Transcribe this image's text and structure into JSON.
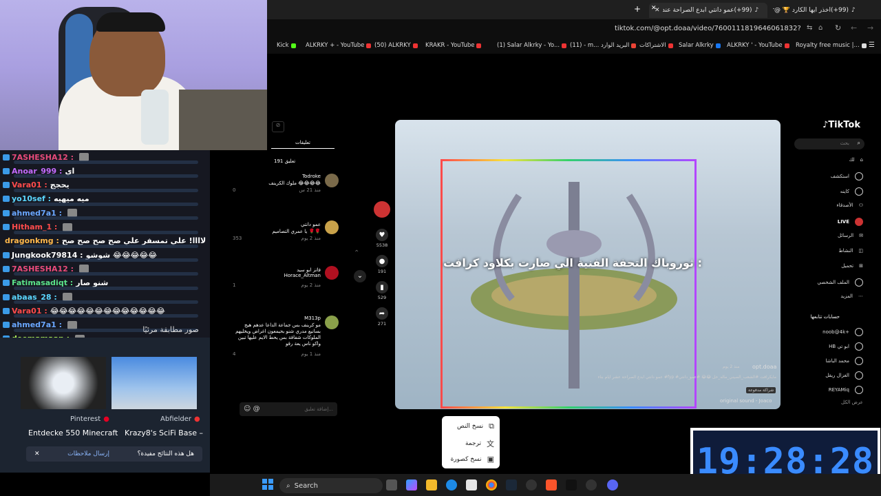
{
  "browser": {
    "tabs": [
      {
        "title": "(99+)اخذر أيها الكارد 🏆 @Over"
      },
      {
        "title": "(99+)عمو دانتي ابدع الصراحة عند"
      }
    ],
    "url": "tiktok.com/@opt.doaa/video/7600111819646061832?lang=ar",
    "bookmarks": [
      "Kick",
      "ALKRKY + - YouTube",
      "(50) ALKRKY",
      "KRAKR - YouTube",
      "(1) Salar Alkrky - Yo...",
      "(11) - m... البريد الوارد",
      "الاشتراكات",
      "Salar Alkrky",
      "ALKRKY ' - YouTube",
      "Royalty free music |..."
    ]
  },
  "chat": {
    "messages": [
      {
        "user": "7ASHESHA12 :",
        "msg": "",
        "color": "#e94b7b"
      },
      {
        "user": "Anoar_999 :",
        "msg": "اي",
        "color": "#c56bff"
      },
      {
        "user": "Vara01 :",
        "msg": "يحجج",
        "color": "#ff4b4b"
      },
      {
        "user": "yo10sef :",
        "msg": "ميه ميهيه",
        "color": "#5bd7ff"
      },
      {
        "user": "ahmed7a1 :",
        "msg": "",
        "color": "#6aa7ff"
      },
      {
        "user": "Hitham_1 :",
        "msg": "",
        "color": "#ff4b4b"
      },
      {
        "user": "dragonkmg :",
        "msg": "علي شوشو لاااا! علي تمسفر علي صح صح صح صح",
        "color": "#ffb84b"
      },
      {
        "user": "Jungkook79814 :",
        "msg": "شوشو 😂😂😂😂😂",
        "color": "#ffffff"
      },
      {
        "user": "7ASHESHA12 :",
        "msg": "",
        "color": "#e94b7b"
      },
      {
        "user": "Fatimasadiqt :",
        "msg": "شنو صار",
        "color": "#5be38a"
      },
      {
        "user": "abaas_28 :",
        "msg": "",
        "color": "#5bd7ff"
      },
      {
        "user": "Vara01 :",
        "msg": "😂😂😂😂😂😂😂😂😂😂😂😂😂",
        "color": "#ff4b4b"
      },
      {
        "user": "ahmed7a1 :",
        "msg": "",
        "color": "#6aa7ff"
      },
      {
        "user": "deemamaan :",
        "msg": "",
        "color": "#b7ff5b"
      }
    ]
  },
  "lens": {
    "header": "صور مطابقة مرئيًا",
    "results": [
      {
        "source": "Pinterest",
        "title": "Entdecke 550 Minecraft"
      },
      {
        "source": "Abfielder",
        "title": "Krazy8's SciFi Base –"
      }
    ],
    "feedback_question": "هل هذه النتائج مفيدة؟",
    "feedback_button": "إرسال ملاحظات"
  },
  "tiktok": {
    "logo": "TikTok",
    "search_placeholder": "بحث",
    "comments_tab": "تعليقات",
    "comments_count": "191 تعليق",
    "comments": [
      {
        "name": "Todroke",
        "text": "ملوك الكرينف 😂😂😂😂",
        "meta": "منذ 21 س",
        "likes": "0"
      },
      {
        "name": "عمو دانتي",
        "text": "يا عمري التصاميم 🌹🌹",
        "meta": "منذ 2 يوم",
        "likes": "353"
      },
      {
        "name": "فاتز ابو سيد Horace_Altman",
        "text": "",
        "meta": "منذ 2 يوم",
        "likes": "1"
      },
      {
        "name": "M313p",
        "text": "مو كرينف بس جماعة الداعا عدهم هيج بسانيع مدري شنو بحيمعون اغراض ويخليهم الملوكات شفافة بس يحط الايم عليها تبين واكو ناس يعة رقو",
        "meta": "منذ 1 يوم",
        "likes": "4"
      }
    ],
    "comment_placeholder": "إضافة تعليق...",
    "video_caption": "ثوروباك التحفة الفنية الي صارت بكلاود كرافت :",
    "author": "opt.doaa",
    "posted": "منذ 2 يوم",
    "description": "عمو دانتي ابدع الصراحة عشر ايام بناء #fyp #مايكرافت #الشعب_الصيني_ماله_حل 😂😂 #عمو_دانتي",
    "promo": "شراكة مدفوعة",
    "sound": "original sound - Joaco",
    "actions": [
      {
        "icon": "heart-icon",
        "count": "5538"
      },
      {
        "icon": "comment-icon",
        "count": "191"
      },
      {
        "icon": "bookmark-icon",
        "count": "529"
      },
      {
        "icon": "share-icon",
        "count": "271"
      }
    ],
    "sidebar": [
      {
        "label": "لك"
      },
      {
        "label": "استكشف"
      },
      {
        "label": "كاينه"
      },
      {
        "label": "الأصدقاء"
      },
      {
        "label": "LIVE"
      },
      {
        "label": "الرسائل"
      },
      {
        "label": "النشاط"
      },
      {
        "label": "تحميل"
      },
      {
        "label": "الملف الشخصي"
      },
      {
        "label": "المزيد"
      }
    ],
    "following_header": "حسابات تتابعها",
    "following": [
      "noob@4k+",
      "HB ابو تي",
      "محمد الباشا",
      "الغزال ريقل",
      "REYAMiq",
      "عرض الكل"
    ]
  },
  "context_menu": {
    "items": [
      "نسخ النص",
      "ترجمة",
      "نسخ كصورة"
    ]
  },
  "clock": {
    "time": "19:28:28"
  },
  "taskbar": {
    "search_label": "Search"
  }
}
